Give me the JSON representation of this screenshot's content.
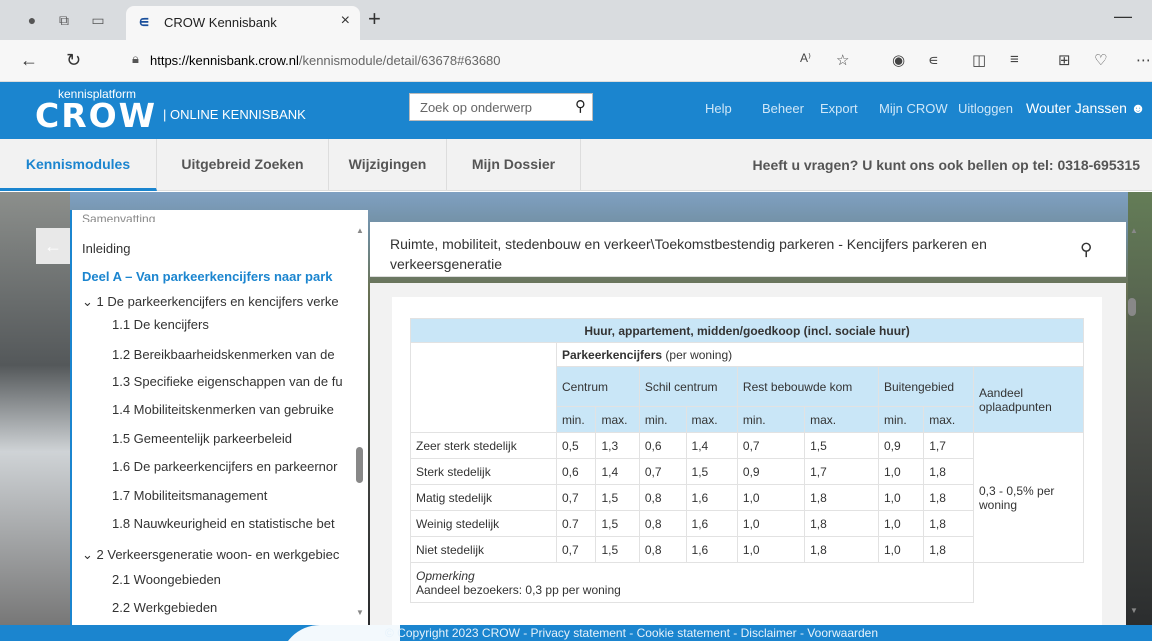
{
  "browser": {
    "tab_title": "CROW Kennisbank",
    "tab_close": "×",
    "new_tab": "+",
    "minimize": "—",
    "url_host": "https://kennisbank.crow.nl",
    "url_path": "/kennismodule/detail/63678#63680",
    "reader_icon": "A⁾"
  },
  "header": {
    "logo_top": "kennisplatform",
    "logo_main": "CROW",
    "section": "| ONLINE KENNISBANK",
    "search_placeholder": "Zoek op onderwerp",
    "links": [
      "Help",
      "Beheer",
      "Export",
      "Mijn CROW",
      "Uitloggen"
    ],
    "user": "Wouter Janssen"
  },
  "nav": {
    "items": [
      "Kennismodules",
      "Uitgebreid Zoeken",
      "Wijzigingen",
      "Mijn Dossier"
    ],
    "phone": "Heeft u vragen? U kunt ons ook bellen op tel: 0318-695315"
  },
  "sidebar": {
    "items": [
      "Samenvatting",
      "Inleiding",
      "Deel A – Van parkeerkencijfers naar park",
      "1 De parkeerkencijfers en kencijfers verke",
      "1.1 De kencijfers",
      "1.2 Bereikbaarheidskenmerken van de",
      "1.3 Specifieke eigenschappen van de fu",
      "1.4 Mobiliteitskenmerken van gebruike",
      "1.5 Gemeentelijk parkeerbeleid",
      "1.6 De parkeerkencijfers en parkeernor",
      "1.7 Mobiliteitsmanagement",
      "1.8 Nauwkeurigheid en statistische bet",
      "2 Verkeersgeneratie woon- en werkgebiec",
      "2.1 Woongebieden",
      "2.2 Werkgebieden"
    ]
  },
  "content": {
    "title": "Ruimte, mobiliteit, stedenbouw en verkeer\\Toekomstbestendig parkeren - Kencijfers parkeren en verkeersgeneratie",
    "table": {
      "caption": "Huur, appartement, midden/goedkoop (incl. sociale huur)",
      "sub_bold": "Parkeerkencijfers",
      "sub_rest": " (per woning)",
      "zones": [
        "Centrum",
        "Schil centrum",
        "Rest bebouwde kom",
        "Buitengebied"
      ],
      "share_header": "Aandeel oplaadpunten",
      "min": "min.",
      "max": "max.",
      "rows": [
        {
          "label": "Zeer sterk stedelijk",
          "values": [
            "0,5",
            "1,3",
            "0,6",
            "1,4",
            "0,7",
            "1,5",
            "0,9",
            "1,7"
          ]
        },
        {
          "label": "Sterk stedelijk",
          "values": [
            "0,6",
            "1,4",
            "0,7",
            "1,5",
            "0,9",
            "1,7",
            "1,0",
            "1,8"
          ]
        },
        {
          "label": "Matig stedelijk",
          "values": [
            "0,7",
            "1,5",
            "0,8",
            "1,6",
            "1,0",
            "1,8",
            "1,0",
            "1,8"
          ]
        },
        {
          "label": "Weinig stedelijk",
          "values": [
            "0.7",
            "1,5",
            "0,8",
            "1,6",
            "1,0",
            "1,8",
            "1,0",
            "1,8"
          ]
        },
        {
          "label": "Niet stedelijk",
          "values": [
            "0,7",
            "1,5",
            "0,8",
            "1,6",
            "1,0",
            "1,8",
            "1,0",
            "1,8"
          ]
        }
      ],
      "share_value": "0,3 - 0,5% per woning",
      "note_title": "Opmerking",
      "note_text": "Aandeel bezoekers: 0,3 pp per woning"
    }
  },
  "footer": {
    "text": "© Copyright 2023 CROW - Privacy statement - Cookie statement - Disclaimer - Voorwaarden"
  },
  "colors": {
    "brand": "#1b85cf",
    "table_header": "#c9e6f7"
  }
}
